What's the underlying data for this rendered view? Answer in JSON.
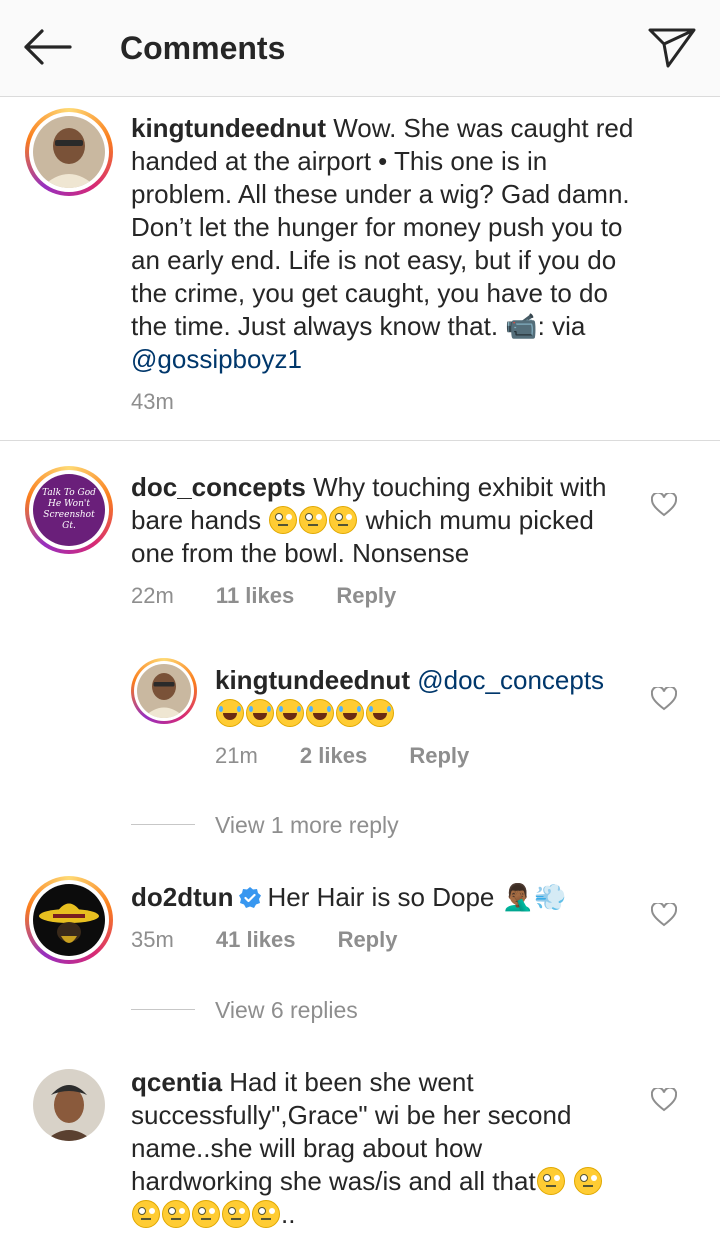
{
  "header": {
    "title": "Comments",
    "back_icon": "arrow-left-icon",
    "send_icon": "paper-plane-icon"
  },
  "caption": {
    "username": "kingtundeednut",
    "text": "Wow. She was caught red handed at the airport • This one is in problem. All these under a wig? Gad damn. Don’t let the hunger for money push you to an early end. Life is not easy, but if you do the crime, you get caught, you have to do the time. Just always know that.",
    "camera_emoji": "📹",
    "after_emoji": ": via ",
    "mention": "@gossipboyz1",
    "time": "43m"
  },
  "comments": [
    {
      "username": "doc_concepts",
      "avatar_text": "Talk To God He Won't Screenshot Gt.",
      "text_a": "Why touching exhibit with bare hands",
      "text_b": "which mumu picked one from the bowl. Nonsense",
      "time": "22m",
      "likes": "11 likes",
      "reply": "Reply"
    },
    {
      "username": "kingtundeednut",
      "mention": "@doc_concepts",
      "time": "21m",
      "likes": "2 likes",
      "reply": "Reply"
    },
    {
      "view_more": "View 1 more reply"
    },
    {
      "username": "do2dtun",
      "verified": true,
      "text": "Her Hair is so Dope",
      "emoji_a": "🤦🏾‍♂️",
      "emoji_b": "💨",
      "time": "35m",
      "likes": "41 likes",
      "reply": "Reply"
    },
    {
      "view_more": "View 6 replies"
    },
    {
      "username": "qcentia",
      "text_a": "Had it been she went successfully\",Grace\" wi be her second name..she will brag about how hardworking she was/is  and all that",
      "text_tail": ".."
    }
  ],
  "colors": {
    "mention": "#00376b",
    "meta": "#8e8e8e",
    "verified": "#3897f0"
  }
}
